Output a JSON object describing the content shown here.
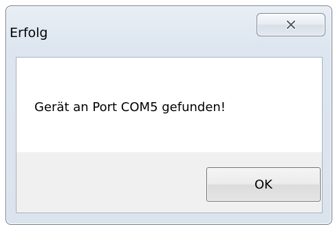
{
  "dialog": {
    "title": "Erfolg",
    "message": "Gerät an Port COM5 gefunden!",
    "ok_label": "OK",
    "close_icon": "close-icon"
  }
}
